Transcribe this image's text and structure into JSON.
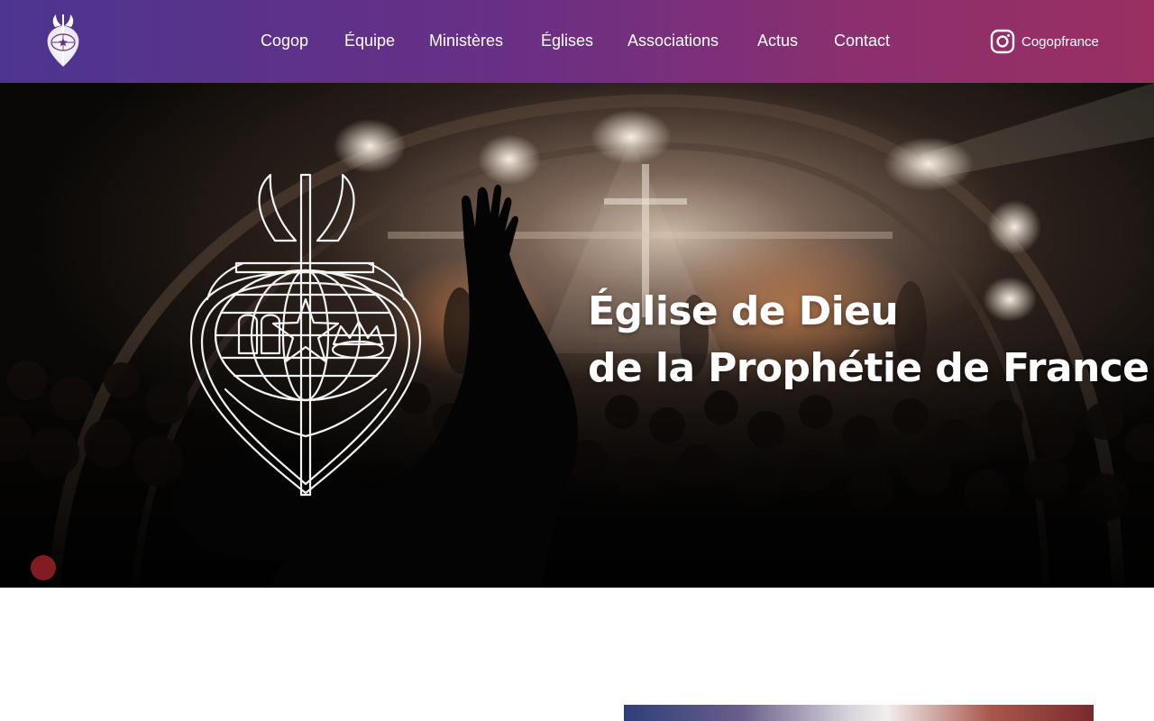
{
  "header": {
    "logo": {
      "icon": "cogop-emblem-icon",
      "alt": "Cogop"
    },
    "nav": [
      {
        "label": "Cogop"
      },
      {
        "label": "Équipe"
      },
      {
        "label": "Ministères"
      },
      {
        "label": "Églises"
      },
      {
        "label": "Associations"
      },
      {
        "label": "Actus"
      },
      {
        "label": "Contact"
      }
    ],
    "social": {
      "icon": "instagram-icon",
      "label": "Cogopfrance"
    },
    "gradient_colors": [
      "#4c3590",
      "#9a2f62"
    ]
  },
  "hero": {
    "title_line1": "Église de Dieu",
    "title_line2": "de la Prophétie de France",
    "background": "concert-crowd-worship-photo",
    "emblem_icon": "cogop-emblem-icon"
  },
  "content": {
    "image": "worship-photo-thumbnail"
  }
}
